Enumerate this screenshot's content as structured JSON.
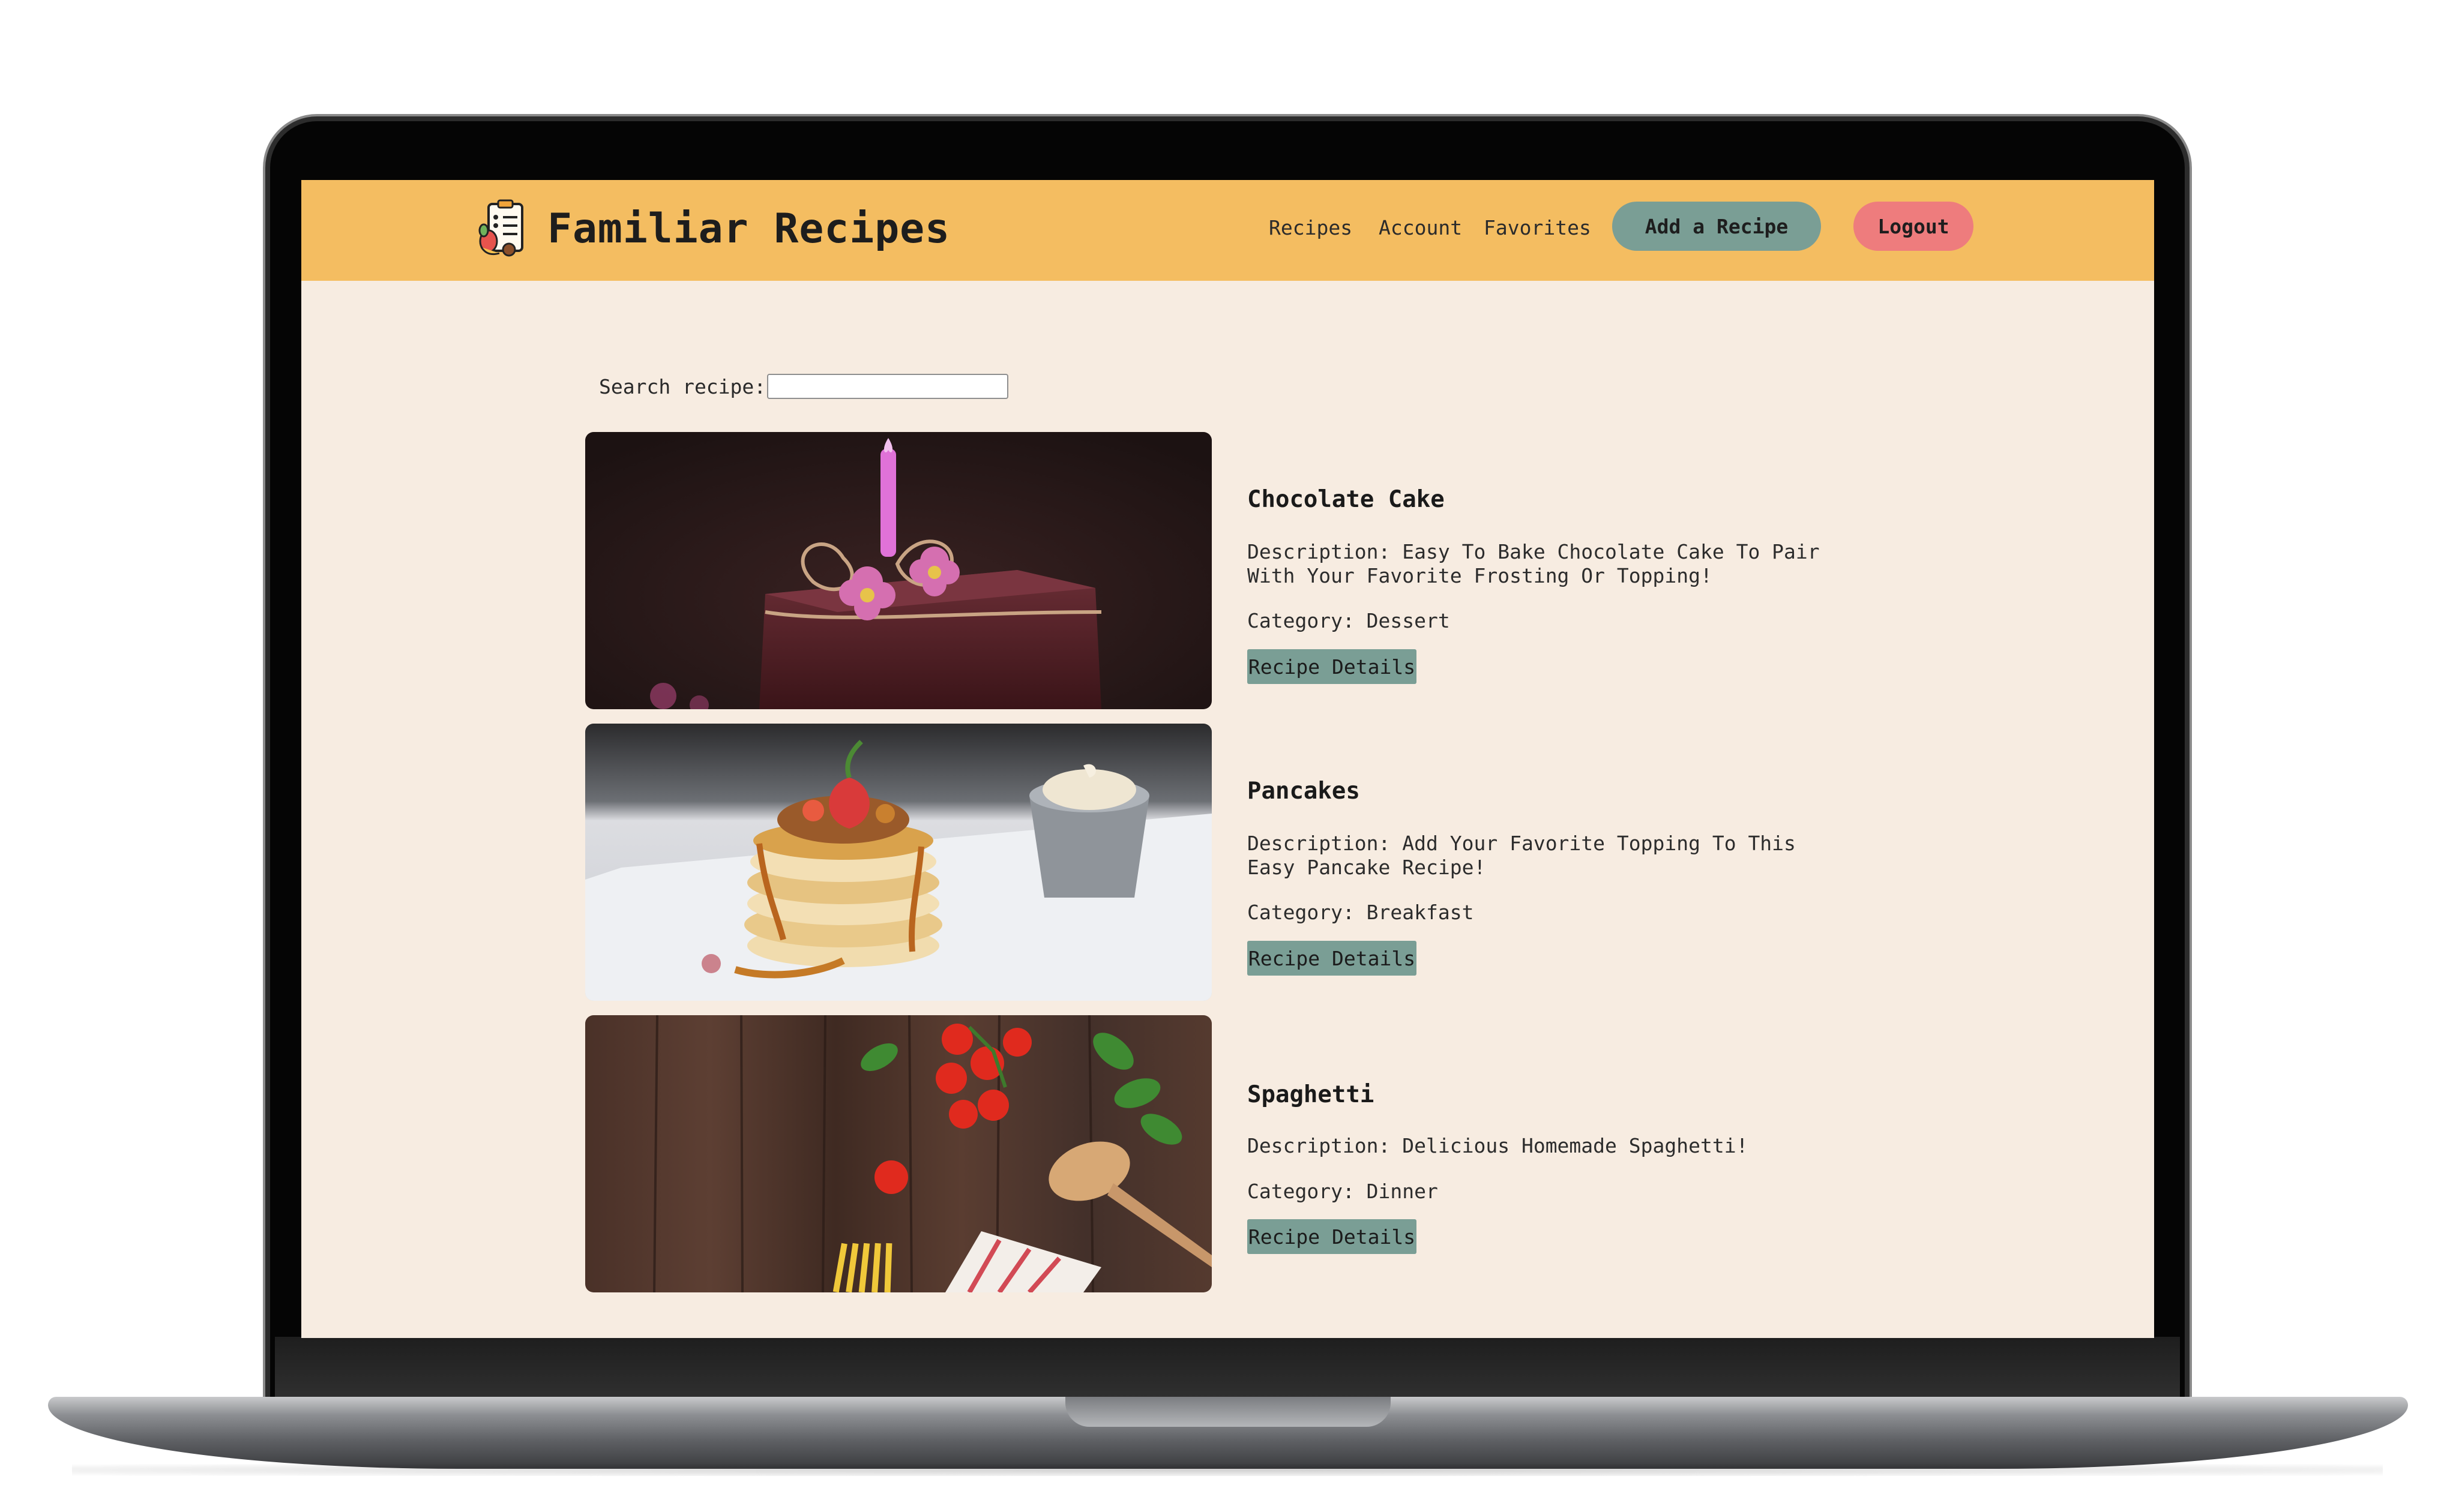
{
  "header": {
    "brand": "Familiar Recipes",
    "nav": [
      {
        "label": "Recipes"
      },
      {
        "label": "Account"
      },
      {
        "label": "Favorites"
      }
    ],
    "add_label": "Add a Recipe",
    "logout_label": "Logout"
  },
  "search": {
    "label": "Search recipe:",
    "value": ""
  },
  "recipes": [
    {
      "title": "Chocolate Cake",
      "description": "Description: Easy To Bake Chocolate Cake To Pair With Your Favorite Frosting Or Topping!",
      "category": "Category: Dessert",
      "button": "Recipe Details"
    },
    {
      "title": "Pancakes",
      "description": "Description: Add Your Favorite Topping To This Easy Pancake Recipe!",
      "category": "Category: Breakfast",
      "button": "Recipe Details"
    },
    {
      "title": "Spaghetti",
      "description": "Description: Delicious Homemade Spaghetti!",
      "category": "Category: Dinner",
      "button": "Recipe Details"
    }
  ],
  "colors": {
    "header": "#f4bd61",
    "page_background": "#f7ece1",
    "accent_green": "#7a9e95",
    "logout_red": "#ee7c7d"
  }
}
